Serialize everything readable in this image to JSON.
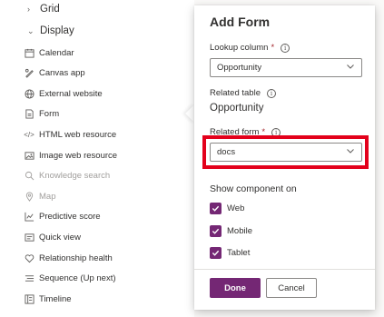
{
  "left_panel": {
    "sections": [
      {
        "label": "Grid",
        "icon": "chevron-right-icon"
      },
      {
        "label": "Display",
        "icon": "chevron-down-icon"
      }
    ],
    "items": [
      {
        "label": "Calendar",
        "icon": "calendar-icon",
        "disabled": false
      },
      {
        "label": "Canvas app",
        "icon": "canvas-app-icon",
        "disabled": false
      },
      {
        "label": "External website",
        "icon": "globe-icon",
        "disabled": false
      },
      {
        "label": "Form",
        "icon": "form-icon",
        "disabled": false
      },
      {
        "label": "HTML web resource",
        "icon": "code-icon",
        "disabled": false
      },
      {
        "label": "Image web resource",
        "icon": "image-icon",
        "disabled": false
      },
      {
        "label": "Knowledge search",
        "icon": "search-icon",
        "disabled": true
      },
      {
        "label": "Map",
        "icon": "map-icon",
        "disabled": true
      },
      {
        "label": "Predictive score",
        "icon": "chart-icon",
        "disabled": false
      },
      {
        "label": "Quick view",
        "icon": "quick-view-icon",
        "disabled": false
      },
      {
        "label": "Relationship health",
        "icon": "heart-icon",
        "disabled": false
      },
      {
        "label": "Sequence (Up next)",
        "icon": "sequence-icon",
        "disabled": false
      },
      {
        "label": "Timeline",
        "icon": "timeline-icon",
        "disabled": false
      }
    ]
  },
  "dialog": {
    "title": "Add Form",
    "lookup_column": {
      "label": "Lookup column",
      "required_mark": "*",
      "value": "Opportunity"
    },
    "related_table": {
      "label": "Related table",
      "value": "Opportunity"
    },
    "related_form": {
      "label": "Related form",
      "required_mark": "*",
      "value": "docs"
    },
    "show_on": {
      "label": "Show component on",
      "options": [
        {
          "label": "Web",
          "checked": true
        },
        {
          "label": "Mobile",
          "checked": true
        },
        {
          "label": "Tablet",
          "checked": true
        }
      ]
    },
    "done_label": "Done",
    "cancel_label": "Cancel"
  },
  "colors": {
    "accent": "#742774",
    "highlight": "#e3001b",
    "link": "#0f6cbd"
  }
}
